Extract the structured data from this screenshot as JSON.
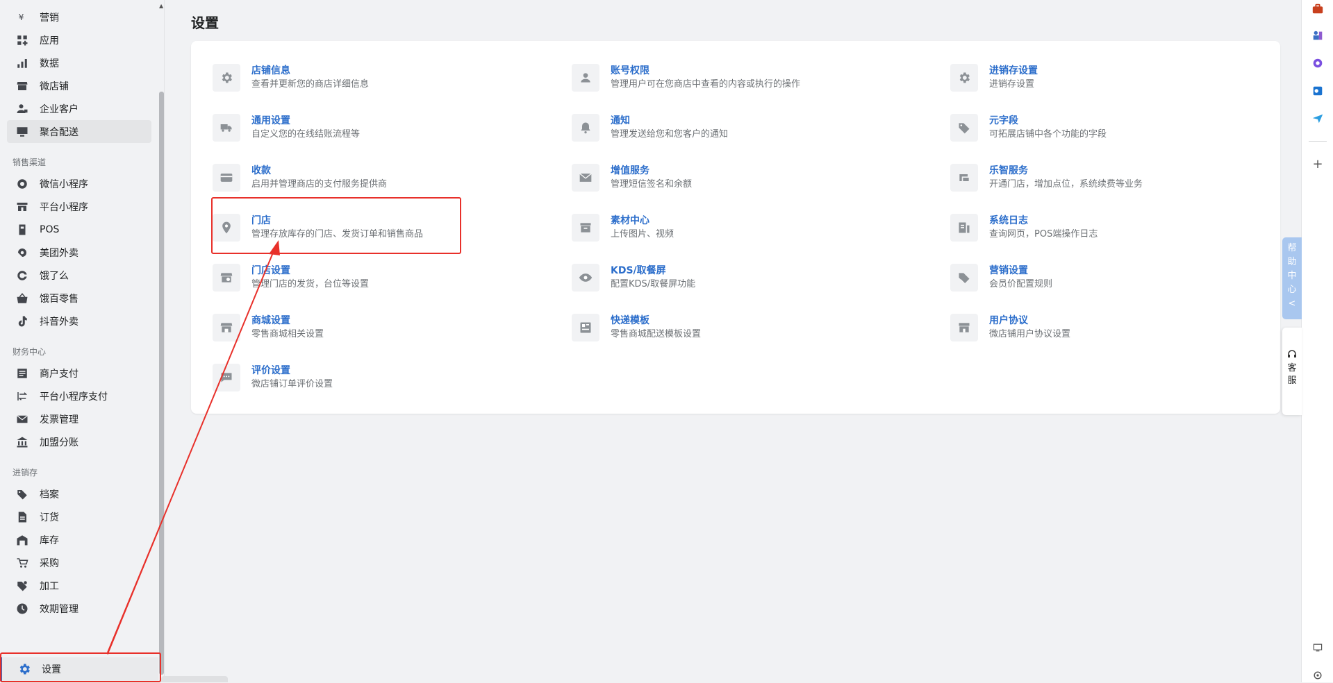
{
  "sidebar": {
    "top_items": [
      {
        "label": "营销",
        "icon": "yen-icon"
      },
      {
        "label": "应用",
        "icon": "apps-icon"
      },
      {
        "label": "数据",
        "icon": "bar-chart-icon"
      },
      {
        "label": "微店铺",
        "icon": "store-icon"
      },
      {
        "label": "企业客户",
        "icon": "business-user-icon"
      },
      {
        "label": "聚合配送",
        "icon": "monitor-icon"
      }
    ],
    "sections": [
      {
        "title": "销售渠道",
        "items": [
          {
            "label": "微信小程序",
            "icon": "wechat-mini-icon"
          },
          {
            "label": "平台小程序",
            "icon": "platform-mini-icon"
          },
          {
            "label": "POS",
            "icon": "pos-icon"
          },
          {
            "label": "美团外卖",
            "icon": "meituan-icon"
          },
          {
            "label": "饿了么",
            "icon": "eleme-icon"
          },
          {
            "label": "饿百零售",
            "icon": "basket-icon"
          },
          {
            "label": "抖音外卖",
            "icon": "tiktok-icon"
          }
        ]
      },
      {
        "title": "财务中心",
        "items": [
          {
            "label": "商户支付",
            "icon": "document-icon"
          },
          {
            "label": "平台小程序支付",
            "icon": "transfer-icon"
          },
          {
            "label": "发票管理",
            "icon": "mail-icon"
          },
          {
            "label": "加盟分账",
            "icon": "bank-icon"
          }
        ]
      },
      {
        "title": "进销存",
        "items": [
          {
            "label": "档案",
            "icon": "tag-icon"
          },
          {
            "label": "订货",
            "icon": "order-icon"
          },
          {
            "label": "库存",
            "icon": "warehouse-icon"
          },
          {
            "label": "采购",
            "icon": "purchase-icon"
          },
          {
            "label": "加工",
            "icon": "process-icon"
          },
          {
            "label": "效期管理",
            "icon": "clock-icon"
          }
        ]
      }
    ],
    "settings_label": "设置"
  },
  "page": {
    "title": "设置"
  },
  "settings": [
    {
      "title": "店铺信息",
      "desc": "查看并更新您的商店详细信息",
      "icon": "gear-icon"
    },
    {
      "title": "账号权限",
      "desc": "管理用户可在您商店中查看的内容或执行的操作",
      "icon": "user-icon"
    },
    {
      "title": "进销存设置",
      "desc": "进销存设置",
      "icon": "gear-icon"
    },
    {
      "title": "通用设置",
      "desc": "自定义您的在线结账流程等",
      "icon": "truck-icon"
    },
    {
      "title": "通知",
      "desc": "管理发送给您和您客户的通知",
      "icon": "bell-icon"
    },
    {
      "title": "元字段",
      "desc": "可拓展店铺中各个功能的字段",
      "icon": "tag-icon"
    },
    {
      "title": "收款",
      "desc": "启用并管理商店的支付服务提供商",
      "icon": "card-icon"
    },
    {
      "title": "增值服务",
      "desc": "管理短信签名和余额",
      "icon": "envelope-icon"
    },
    {
      "title": "乐智服务",
      "desc": "开通门店，增加点位，系统续费等业务",
      "icon": "service-icon"
    },
    {
      "title": "门店",
      "desc": "管理存放库存的门店、发货订单和销售商品",
      "icon": "location-icon"
    },
    {
      "title": "素材中心",
      "desc": "上传图片、视频",
      "icon": "archive-icon"
    },
    {
      "title": "系统日志",
      "desc": "查询网页，POS端操作日志",
      "icon": "log-icon"
    },
    {
      "title": "门店设置",
      "desc": "管理门店的发货，台位等设置",
      "icon": "store-settings-icon"
    },
    {
      "title": "KDS/取餐屏",
      "desc": "配置KDS/取餐屏功能",
      "icon": "eye-icon"
    },
    {
      "title": "营销设置",
      "desc": "会员价配置规则",
      "icon": "tags-icon"
    },
    {
      "title": "商城设置",
      "desc": "零售商城相关设置",
      "icon": "shop-icon"
    },
    {
      "title": "快递模板",
      "desc": "零售商城配送模板设置",
      "icon": "template-icon"
    },
    {
      "title": "用户协议",
      "desc": "微店铺用户协议设置",
      "icon": "storefront-icon"
    },
    {
      "title": "评价设置",
      "desc": "微店铺订单评价设置",
      "icon": "comment-icon"
    }
  ],
  "help_rail": {
    "help_tab": [
      "帮",
      "助",
      "中",
      "心",
      "<"
    ],
    "cs_tab": [
      "客",
      "服"
    ]
  }
}
